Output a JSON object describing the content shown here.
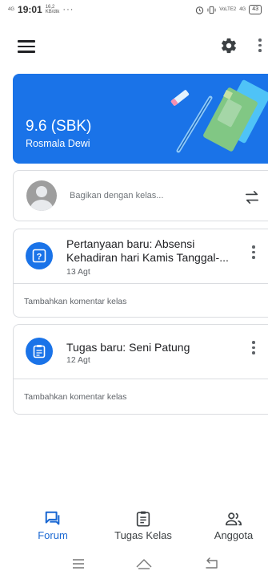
{
  "status_bar": {
    "signal": "4G",
    "time": "19:01",
    "speed_value": "16,2",
    "speed_unit": "KB/dtk",
    "dots": "···",
    "volte": "VoLTE2",
    "network": "4G",
    "battery": "43"
  },
  "colors": {
    "accent": "#1a73e8",
    "nav_active": "#1967d2",
    "text_primary": "#202124",
    "text_secondary": "#5f6368",
    "divider": "#dadce0"
  },
  "app_bar": {
    "menu_icon": "hamburger-icon",
    "settings_icon": "gear-icon",
    "overflow_icon": "more-vert-icon"
  },
  "banner": {
    "title": "9.6 (SBK)",
    "subtitle": "Rosmala Dewi"
  },
  "share": {
    "placeholder": "Bagikan dengan kelas...",
    "repost_icon": "swap-icon"
  },
  "posts": [
    {
      "icon": "question-icon",
      "title": "Pertanyaan baru: Absensi Kehadiran hari Kamis Tanggal-...",
      "date": "13 Agt",
      "comment": "Tambahkan komentar kelas"
    },
    {
      "icon": "assignment-icon",
      "title": "Tugas baru: Seni Patung",
      "date": "12 Agt",
      "comment": "Tambahkan komentar kelas"
    }
  ],
  "bottom_nav": [
    {
      "label": "Forum",
      "icon": "forum-icon",
      "active": true
    },
    {
      "label": "Tugas Kelas",
      "icon": "classwork-icon",
      "active": false
    },
    {
      "label": "Anggota",
      "icon": "people-icon",
      "active": false
    }
  ],
  "system_nav": [
    "menu-icon",
    "home-icon",
    "back-icon"
  ]
}
